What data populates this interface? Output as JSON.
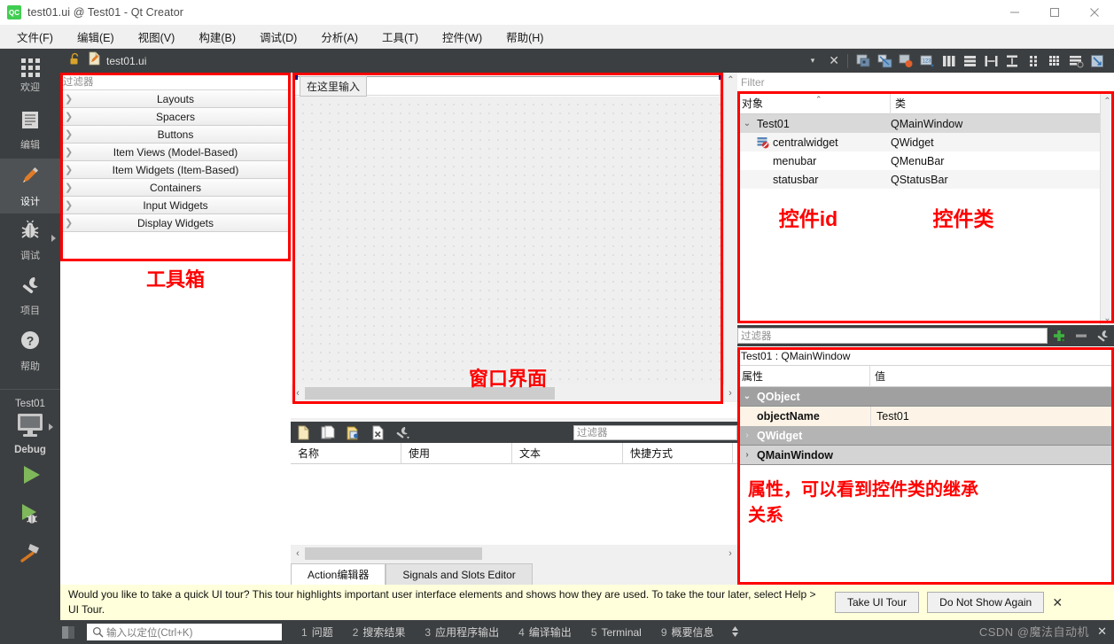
{
  "window": {
    "title": "test01.ui @ Test01 - Qt Creator",
    "logo_text": "QC",
    "minimize": "minimize-icon",
    "maximize": "maximize-icon",
    "close": "close-icon"
  },
  "menubar": {
    "items": [
      {
        "label": "文件(F)"
      },
      {
        "label": "编辑(E)"
      },
      {
        "label": "视图(V)"
      },
      {
        "label": "构建(B)"
      },
      {
        "label": "调试(D)"
      },
      {
        "label": "分析(A)"
      },
      {
        "label": "工具(T)"
      },
      {
        "label": "控件(W)"
      },
      {
        "label": "帮助(H)"
      }
    ]
  },
  "modebar": {
    "modes": [
      {
        "label": "欢迎",
        "icon": "grid-icon",
        "active": false,
        "arrow": false
      },
      {
        "label": "编辑",
        "icon": "document-icon",
        "active": false,
        "arrow": false
      },
      {
        "label": "设计",
        "icon": "pencil-icon",
        "active": true,
        "arrow": false
      },
      {
        "label": "调试",
        "icon": "bug-icon",
        "active": false,
        "arrow": true
      },
      {
        "label": "项目",
        "icon": "wrench-icon",
        "active": false,
        "arrow": false
      },
      {
        "label": "帮助",
        "icon": "question-icon",
        "active": false,
        "arrow": false
      }
    ],
    "kit": {
      "project": "Test01",
      "config": "Debug",
      "icon": "monitor-icon"
    },
    "run_buttons": [
      {
        "name": "run-button",
        "icon": "play-icon"
      },
      {
        "name": "debug-button",
        "icon": "play-bug-icon"
      },
      {
        "name": "build-button",
        "icon": "hammer-icon"
      }
    ]
  },
  "editor_toolbar": {
    "lock_icon": "lock-open-icon",
    "file_icon": "ui-file-icon",
    "file_name": "test01.ui",
    "dropdown_caret": "▾",
    "close_label": "✕",
    "design_tools": [
      {
        "name": "edit-widgets-tool",
        "icon": "edit-widgets-icon"
      },
      {
        "name": "edit-signals-slots-tool",
        "icon": "signals-slots-icon"
      },
      {
        "name": "edit-buddies-tool",
        "icon": "buddies-icon"
      },
      {
        "name": "edit-tab-order-tool",
        "icon": "tab-order-icon"
      },
      {
        "name": "layout-horizontally-tool",
        "icon": "layout-horizontal-icon"
      },
      {
        "name": "layout-vertically-tool",
        "icon": "layout-vertical-icon"
      },
      {
        "name": "layout-splitter-horizontal-tool",
        "icon": "splitter-horizontal-icon"
      },
      {
        "name": "layout-splitter-vertical-tool",
        "icon": "splitter-vertical-icon"
      },
      {
        "name": "layout-form-tool",
        "icon": "form-layout-icon"
      },
      {
        "name": "layout-grid-tool",
        "icon": "grid-layout-icon"
      },
      {
        "name": "break-layout-tool",
        "icon": "break-layout-icon"
      },
      {
        "name": "adjust-size-tool",
        "icon": "adjust-size-icon"
      }
    ]
  },
  "widgetbox": {
    "filter_placeholder": "过滤器",
    "categories": [
      {
        "label": "Layouts"
      },
      {
        "label": "Spacers"
      },
      {
        "label": "Buttons"
      },
      {
        "label": "Item Views (Model-Based)"
      },
      {
        "label": "Item Widgets (Item-Based)"
      },
      {
        "label": "Containers"
      },
      {
        "label": "Input Widgets"
      },
      {
        "label": "Display Widgets"
      }
    ],
    "annotation": "工具箱"
  },
  "form": {
    "menubar_placeholder": "在这里输入",
    "annotation": "窗口界面",
    "scroll_up": "⌃",
    "scroll_down": "⌄",
    "hscroll_left": "‹",
    "hscroll_right": "›"
  },
  "action_editor": {
    "toolbar": [
      {
        "name": "new-action-button",
        "icon": "new-file-icon"
      },
      {
        "name": "copy-action-button",
        "icon": "copy-icon"
      },
      {
        "name": "paste-action-button",
        "icon": "paste-icon"
      },
      {
        "name": "delete-action-button",
        "icon": "delete-file-icon"
      },
      {
        "name": "configure-action-button",
        "icon": "wrench-icon"
      }
    ],
    "filter_placeholder": "过滤器",
    "columns": [
      "名称",
      "使用",
      "文本",
      "快捷方式"
    ],
    "rows": [],
    "tabs": [
      {
        "label": "Action编辑器",
        "active": true
      },
      {
        "label": "Signals and Slots Editor",
        "active": false
      }
    ],
    "hscroll_left": "‹",
    "hscroll_right": "›"
  },
  "object_inspector": {
    "filter_placeholder": "Filter",
    "columns": [
      "对象",
      "类"
    ],
    "sort_indicator": "⌃",
    "rows": [
      {
        "name": "Test01",
        "class": "QMainWindow",
        "indent": 0,
        "expander": "⌄",
        "selected": true,
        "icon": null
      },
      {
        "name": "centralwidget",
        "class": "QWidget",
        "indent": 1,
        "expander": "",
        "selected": false,
        "icon": "central-widget-icon"
      },
      {
        "name": "menubar",
        "class": "QMenuBar",
        "indent": 1,
        "expander": "",
        "selected": false,
        "icon": null
      },
      {
        "name": "statusbar",
        "class": "QStatusBar",
        "indent": 1,
        "expander": "",
        "selected": false,
        "icon": null
      }
    ],
    "annotation_id": "控件id",
    "annotation_class": "控件类",
    "scroll_up": "⌃",
    "scroll_down": "⌄"
  },
  "property_editor": {
    "filter_placeholder": "过滤器",
    "add_icon": "plus-icon",
    "remove_icon": "minus-icon",
    "configure_icon": "wrench-icon",
    "subject": "Test01 : QMainWindow",
    "columns": [
      "属性",
      "值"
    ],
    "groups": [
      {
        "label": "QObject",
        "expander": "⌄",
        "expanded": true
      },
      {
        "label": "QWidget",
        "expander": "›",
        "expanded": false
      },
      {
        "label": "QMainWindow",
        "expander": "›",
        "expanded": false
      }
    ],
    "properties": [
      {
        "name": "objectName",
        "value": "Test01",
        "after_group": "QObject"
      }
    ],
    "annotation_line1": "属性，可以看到控件类的继承",
    "annotation_line2": "关系"
  },
  "info_banner": {
    "message": "Would you like to take a quick UI tour? This tour highlights important user interface elements and shows how they are used. To take the tour later, select Help > UI Tour.",
    "primary_button": "Take UI Tour",
    "secondary_button": "Do Not Show Again",
    "close": "✕"
  },
  "statusbar": {
    "locator_placeholder": "输入以定位(Ctrl+K)",
    "search_icon": "search-icon",
    "panel_toggle_icon": "sidebar-toggle-icon",
    "items": [
      {
        "num": "1",
        "label": "问题"
      },
      {
        "num": "2",
        "label": "搜索结果"
      },
      {
        "num": "3",
        "label": "应用程序输出"
      },
      {
        "num": "4",
        "label": "编译输出"
      },
      {
        "num": "5",
        "label": "Terminal"
      },
      {
        "num": "9",
        "label": "概要信息"
      }
    ],
    "updown_icon": "updown-icon",
    "watermark": "CSDN @魔法自动机",
    "close": "✕"
  },
  "colors": {
    "accent_red": "#ff0000",
    "dark_panel": "#3c3f41",
    "banner_bg": "#ffffdc",
    "selection": "#d9d9d9",
    "property_row": "#fdf4e7",
    "group_gray": "#a0a0a0"
  }
}
